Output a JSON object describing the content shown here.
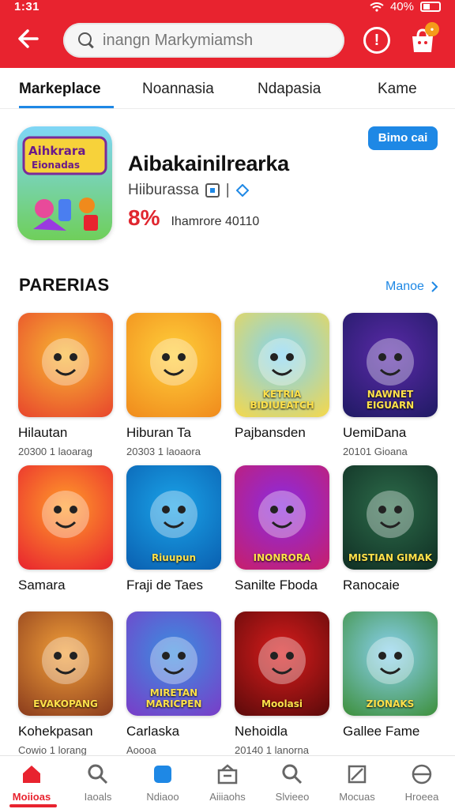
{
  "status_bar": {
    "time": "1:31",
    "battery": "40%"
  },
  "header": {
    "search_placeholder": "inangn Markymiamsh"
  },
  "tabs": [
    {
      "label": "Markeplace"
    },
    {
      "label": "Noannasia"
    },
    {
      "label": "Ndapasia"
    },
    {
      "label": "Kame"
    }
  ],
  "featured": {
    "icon_text_top": "Aihkrara",
    "icon_text_bottom": "Eionadas",
    "title": "Aibakainilrearka",
    "subtitle": "Hiiburassa",
    "badge": "8%",
    "meta": "Ihamrore 40110",
    "install_label": "Bimo cai"
  },
  "section": {
    "title": "PARERIAS",
    "more_label": "Manoe"
  },
  "games": [
    {
      "name": "Hilautan",
      "meta": "20300 1 laoarag",
      "icon_text": "",
      "bg": [
        "#f7b733",
        "#e8452c"
      ]
    },
    {
      "name": "Hiburan Ta",
      "meta": "20303 1 laoaora",
      "icon_text": "",
      "bg": [
        "#ffcf3a",
        "#f08a1c"
      ]
    },
    {
      "name": "Pajbansden",
      "meta": "",
      "icon_text": "KETRIA BIDIUEATCH",
      "bg": [
        "#7fd3f5",
        "#f5d84a"
      ]
    },
    {
      "name": "UemiDana",
      "meta": "20101 Gioana",
      "icon_text": "NAWNET EIGUARN",
      "bg": [
        "#5a2aa8",
        "#1f1a63"
      ]
    },
    {
      "name": "Samara",
      "meta": "",
      "icon_text": "",
      "bg": [
        "#ff9d2a",
        "#e8232f"
      ]
    },
    {
      "name": "Fraji de Taes",
      "meta": "",
      "icon_text": "Riuupun",
      "bg": [
        "#1aa3e8",
        "#0a5fb0"
      ]
    },
    {
      "name": "Sanilte Fboda",
      "meta": "",
      "icon_text": "INONRORA",
      "bg": [
        "#8a2be2",
        "#c81e6a"
      ]
    },
    {
      "name": "Ranocaie",
      "meta": "",
      "icon_text": "MISTIAN GIMAK",
      "bg": [
        "#2d6b4a",
        "#0f2e23"
      ]
    },
    {
      "name": "Kohekpasan",
      "meta": "Cowio 1 lorang",
      "icon_text": "EVAKOPANG",
      "bg": [
        "#f2a03a",
        "#8a3b1c"
      ]
    },
    {
      "name": "Carlaska",
      "meta": "Aoooa",
      "icon_text": "MIRETAN MARICPEN",
      "bg": [
        "#3a8fe0",
        "#7a3cc8"
      ]
    },
    {
      "name": "Nehoidla",
      "meta": "20140 1 lanorna",
      "icon_text": "Moolasi",
      "bg": [
        "#d91c1c",
        "#5a0a0a"
      ]
    },
    {
      "name": "Gallee Fame",
      "meta": "",
      "icon_text": "ZIONAKS",
      "bg": [
        "#8ad1f0",
        "#3d8f3a"
      ]
    }
  ],
  "bottom_nav": [
    {
      "label": "Moiioas",
      "icon": "home-icon"
    },
    {
      "label": "Iaoals",
      "icon": "search-icon"
    },
    {
      "label": "Ndiaoo",
      "icon": "edit-icon"
    },
    {
      "label": "Aiiiaohs",
      "icon": "store-icon"
    },
    {
      "label": "Slvieeo",
      "icon": "search-icon"
    },
    {
      "label": "Mocuas",
      "icon": "ticket-icon"
    },
    {
      "label": "Hroeea",
      "icon": "profile-icon"
    }
  ],
  "colors": {
    "brand_red": "#e8232f",
    "accent_blue": "#1e88e5"
  }
}
